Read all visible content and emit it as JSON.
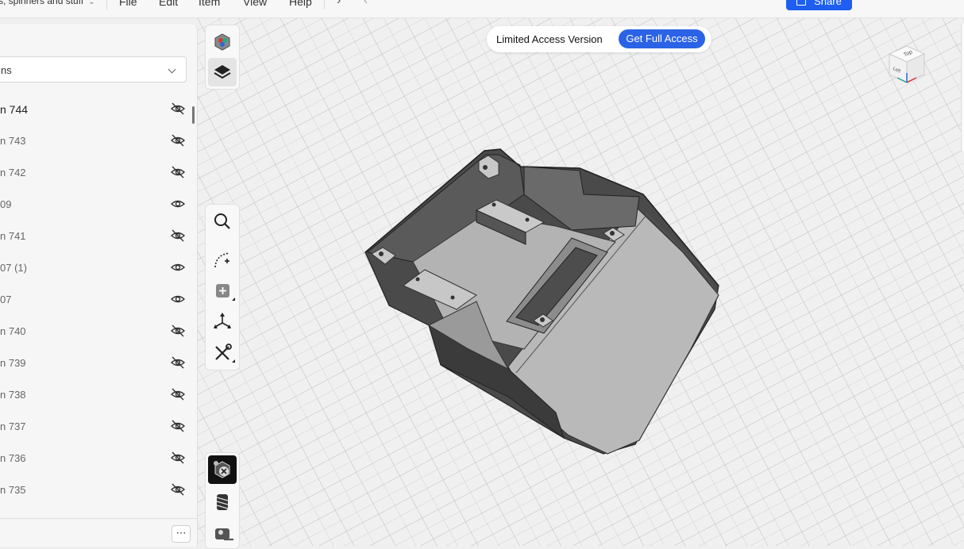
{
  "topbar": {
    "project_title": "s, spinners and stuff",
    "menus": [
      "File",
      "Edit",
      "Item",
      "View",
      "Help"
    ],
    "share_label": "Share"
  },
  "left_panel": {
    "dropdown_value": "ns",
    "items": [
      {
        "label": "n 744",
        "visibility": "hidden"
      },
      {
        "label": "n 743",
        "visibility": "hidden"
      },
      {
        "label": "n 742",
        "visibility": "hidden"
      },
      {
        "label": "09",
        "visibility": "visible"
      },
      {
        "label": "n 741",
        "visibility": "hidden"
      },
      {
        "label": "07 (1)",
        "visibility": "visible"
      },
      {
        "label": "07",
        "visibility": "visible"
      },
      {
        "label": "n 740",
        "visibility": "hidden"
      },
      {
        "label": "n 739",
        "visibility": "hidden"
      },
      {
        "label": "n 738",
        "visibility": "hidden"
      },
      {
        "label": "n 737",
        "visibility": "hidden"
      },
      {
        "label": "n 736",
        "visibility": "hidden"
      },
      {
        "label": "n 735",
        "visibility": "hidden"
      }
    ],
    "more_label": "⋯"
  },
  "toolbar_top": [
    "appearance-icon",
    "layers-icon"
  ],
  "toolbar_mid": [
    "search-icon",
    "add-sketch-icon",
    "add-object-icon",
    "transform-icon",
    "tools-icon"
  ],
  "toolbar_bottom": [
    "render-icon",
    "thread-icon",
    "measure-icon"
  ],
  "banner": {
    "message": "Limited Access Version",
    "cta": "Get Full Access"
  },
  "view_cube": {
    "top_label": "Top",
    "left_label": "Left"
  },
  "colors": {
    "accent": "#1e5ef0",
    "cta": "#2b63e6"
  }
}
